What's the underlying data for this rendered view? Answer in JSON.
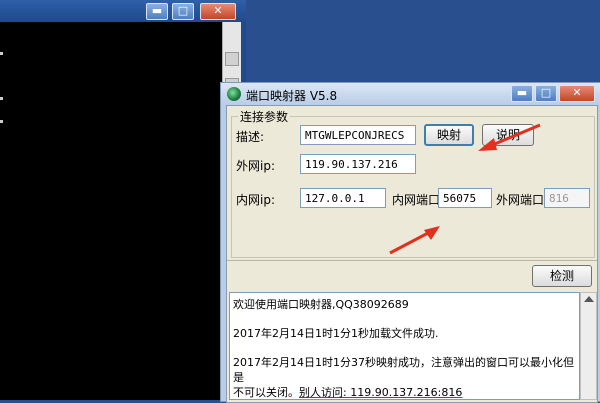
{
  "app": {
    "title": "端口映射器 V5.8",
    "group_title": "连接参数",
    "desc_label": "描述:",
    "desc_value": "MTGWLEPCONJRECS",
    "map_button": "映射",
    "help_button": "说明",
    "ext_ip_label": "外网ip:",
    "ext_ip_value": "119.90.137.216",
    "int_ip_label": "内网ip:",
    "int_ip_value": "127.0.0.1",
    "int_port_label": "内网端口",
    "int_port_value": "56075",
    "ext_port_label": "外网端口",
    "ext_port_value": "816",
    "check_button": "检测",
    "log": {
      "line1": "欢迎使用端口映射器,QQ38092689",
      "line2": "2017年2月14日1时1分1秒加载文件成功.",
      "line3": "2017年2月14日1时1分37秒映射成功，注意弹出的窗口可以最小化但是",
      "line4a": "不可以关闭。",
      "line4b": "别人访问: 119.90.137.216:816"
    }
  },
  "console": {
    "min_glyph": "▬",
    "max_glyph": "□",
    "close_glyph": "✕"
  },
  "app_controls": {
    "min_glyph": "▬",
    "max_glyph": "□",
    "close_glyph": "✕"
  },
  "colors": {
    "arrow": "#e0301e",
    "desktop": "#2a4f8f"
  }
}
